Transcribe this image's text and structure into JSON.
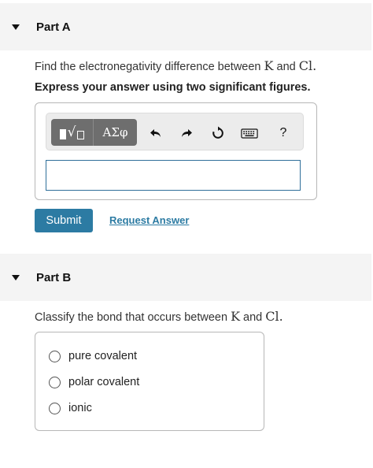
{
  "partA": {
    "title": "Part A",
    "question_prefix": "Find the electronegativity difference between ",
    "elem1": "K",
    "question_mid": " and ",
    "elem2": "Cl",
    "question_suffix": ".",
    "instruction": "Express your answer using two significant figures.",
    "toolbar": {
      "greek_label": "ΑΣφ",
      "sqrt_glyph": "√",
      "help_label": "?"
    },
    "answer_value": "",
    "submit_label": "Submit",
    "request_label": "Request Answer"
  },
  "partB": {
    "title": "Part B",
    "question_prefix": "Classify the bond that occurs between ",
    "elem1": "K",
    "question_mid": " and ",
    "elem2": "Cl",
    "question_suffix": ".",
    "options": [
      {
        "label": "pure covalent"
      },
      {
        "label": "polar covalent"
      },
      {
        "label": "ionic"
      }
    ]
  },
  "icons": {
    "caret": "caret-down-icon",
    "undo": "undo-icon",
    "redo": "redo-icon",
    "reset": "reset-icon",
    "keyboard": "keyboard-icon",
    "help": "help-icon"
  },
  "colors": {
    "accent": "#2c7ba3",
    "toolbar_button": "#6e6e6e",
    "header_bg": "#f4f4f4"
  }
}
